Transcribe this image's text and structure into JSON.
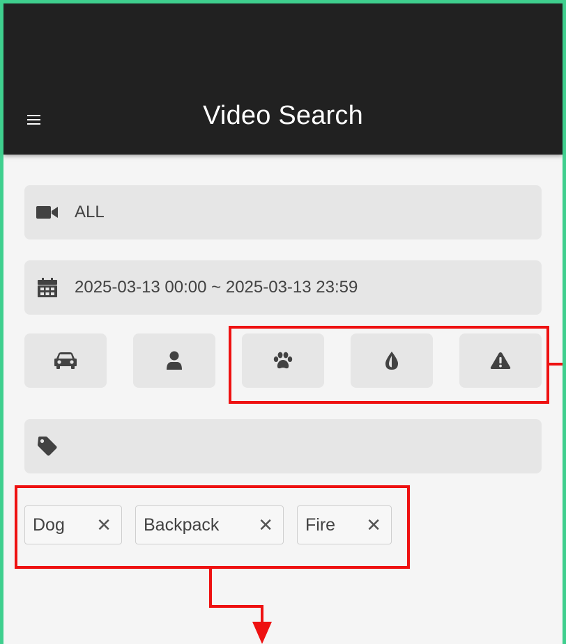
{
  "app": {
    "title": "Video Search"
  },
  "filters": {
    "camera": {
      "icon": "video-camera-icon",
      "value": "ALL"
    },
    "date_range": {
      "icon": "calendar-icon",
      "value": "2025-03-13 00:00 ~ 2025-03-13 23:59"
    },
    "object_types": [
      {
        "name": "vehicle",
        "icon": "car-icon"
      },
      {
        "name": "person",
        "icon": "person-icon"
      },
      {
        "name": "animal",
        "icon": "paw-icon"
      },
      {
        "name": "liquid",
        "icon": "droplet-icon"
      },
      {
        "name": "alert",
        "icon": "warning-icon"
      }
    ],
    "tags_input": {
      "icon": "tag-icon",
      "value": ""
    },
    "selected_tags": [
      {
        "label": "Dog",
        "remove": "✕"
      },
      {
        "label": "Backpack",
        "remove": "✕"
      },
      {
        "label": "Fire",
        "remove": "✕"
      }
    ]
  },
  "colors": {
    "appbar": "#212121",
    "background": "#f5f5f5",
    "field": "#e6e6e6",
    "icon": "#424242",
    "annotation": "#ee1111",
    "frame": "#3fcf8e"
  }
}
